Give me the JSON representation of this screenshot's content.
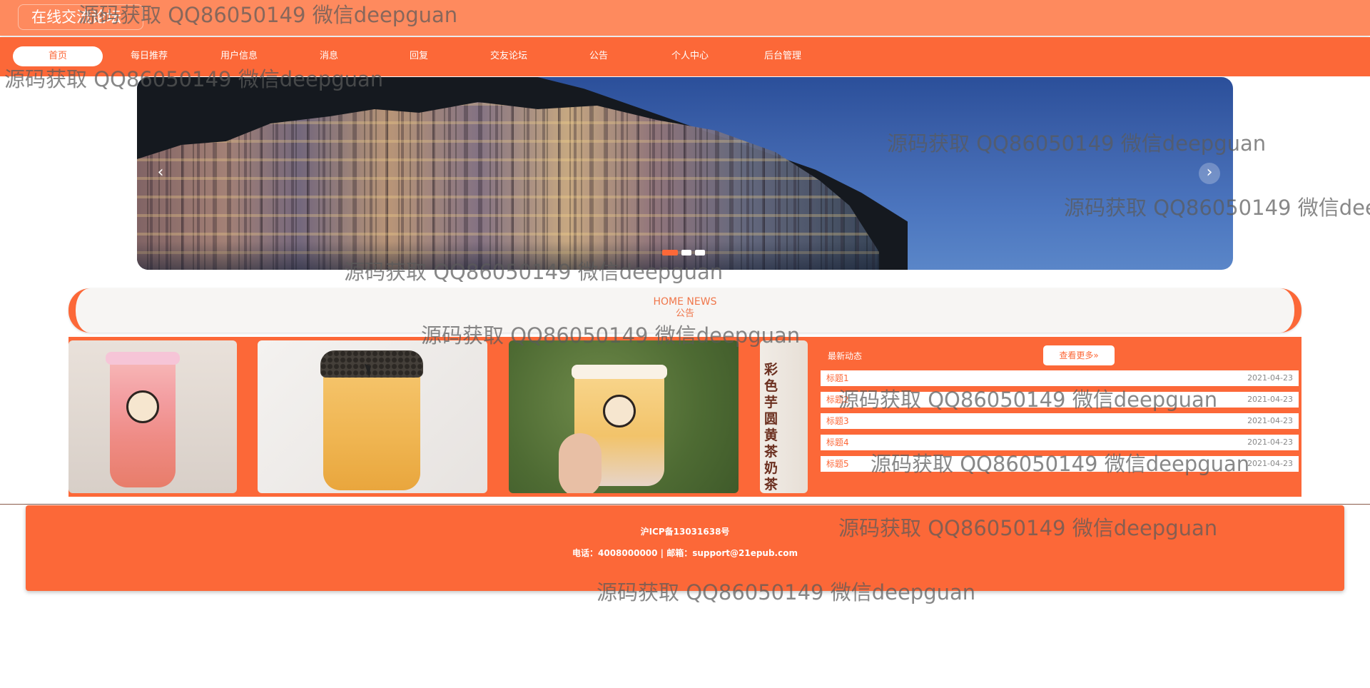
{
  "site": {
    "title": "在线交流论坛"
  },
  "nav": {
    "items": [
      {
        "label": "首页",
        "active": true
      },
      {
        "label": "每日推荐"
      },
      {
        "label": "用户信息"
      },
      {
        "label": "消息"
      },
      {
        "label": "回复"
      },
      {
        "label": "交友论坛"
      },
      {
        "label": "公告"
      },
      {
        "label": "个人中心"
      },
      {
        "label": "后台管理"
      }
    ]
  },
  "banner": {
    "prev_icon": "chevron-left-icon",
    "next_icon": "chevron-right-icon",
    "slide_count": 3,
    "active_slide": 1
  },
  "section": {
    "title_en": "HOME NEWS",
    "title_cn": "公告"
  },
  "products": {
    "vertical_text": "彩色芋圆黄茶奶茶"
  },
  "news": {
    "title": "最新动态",
    "more_label": "查看更多»",
    "items": [
      {
        "title": "标题1",
        "date": "2021-04-23"
      },
      {
        "title": "标题2",
        "date": "2021-04-23"
      },
      {
        "title": "标题3",
        "date": "2021-04-23"
      },
      {
        "title": "标题4",
        "date": "2021-04-23"
      },
      {
        "title": "标题5",
        "date": "2021-04-23"
      }
    ]
  },
  "footer": {
    "icp": "沪ICP备13031638号",
    "contact": "电话：4008000000 | 邮箱：support@21epub.com"
  },
  "watermark": {
    "text": "源码获取 QQ86050149 微信deepguan"
  },
  "colors": {
    "primary": "#fc6838",
    "topbar": "#fe8a5e"
  }
}
